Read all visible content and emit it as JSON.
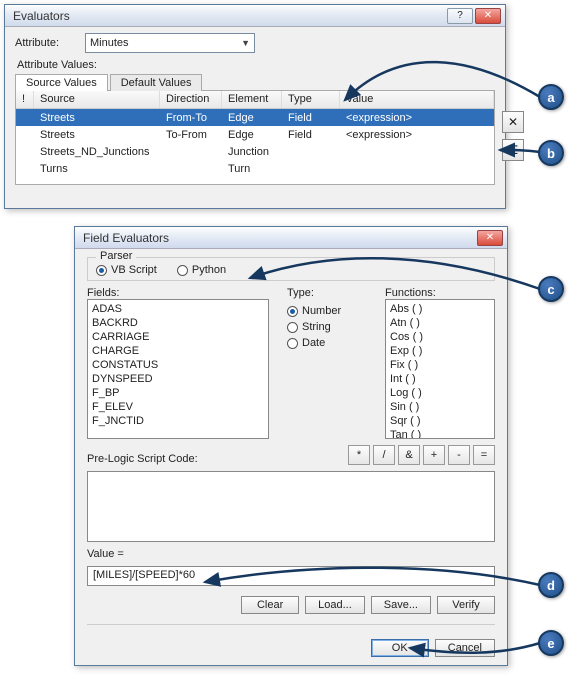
{
  "evaluators": {
    "title": "Evaluators",
    "attribute_label": "Attribute:",
    "attribute_value": "Minutes",
    "values_label": "Attribute Values:",
    "tabs": {
      "source": "Source Values",
      "default": "Default Values"
    },
    "columns": {
      "bang": "!",
      "source": "Source",
      "direction": "Direction",
      "element": "Element",
      "type": "Type",
      "value": "Value"
    },
    "rows": [
      {
        "source": "Streets",
        "direction": "From-To",
        "element": "Edge",
        "type": "Field",
        "value": "<expression>",
        "selected": true
      },
      {
        "source": "Streets",
        "direction": "To-From",
        "element": "Edge",
        "type": "Field",
        "value": "<expression>",
        "selected": false
      },
      {
        "source": "Streets_ND_Junctions",
        "direction": "",
        "element": "Junction",
        "type": "",
        "value": "",
        "selected": false
      },
      {
        "source": "Turns",
        "direction": "",
        "element": "Turn",
        "type": "",
        "value": "",
        "selected": false
      }
    ],
    "side_buttons": {
      "delete": "✕",
      "props": "☰"
    }
  },
  "field_eval": {
    "title": "Field Evaluators",
    "parser_label": "Parser",
    "parser_vb": "VB Script",
    "parser_py": "Python",
    "fields_label": "Fields:",
    "fields": [
      "ADAS",
      "BACKRD",
      "CARRIAGE",
      "CHARGE",
      "CONSTATUS",
      "DYNSPEED",
      "F_BP",
      "F_ELEV",
      "F_JNCTID"
    ],
    "type_label": "Type:",
    "type_number": "Number",
    "type_string": "String",
    "type_date": "Date",
    "functions_label": "Functions:",
    "functions": [
      "Abs ( )",
      "Atn ( )",
      "Cos ( )",
      "Exp ( )",
      "Fix ( )",
      "Int ( )",
      "Log ( )",
      "Sin ( )",
      "Sqr ( )",
      "Tan ( )"
    ],
    "prelogic_label": "Pre-Logic Script Code:",
    "ops": {
      "mul": "*",
      "div": "/",
      "amp": "&",
      "plus": "+",
      "minus": "-",
      "eq": "="
    },
    "value_label": "Value =",
    "value_expr": "[MILES]/[SPEED]*60",
    "buttons": {
      "clear": "Clear",
      "load": "Load...",
      "save": "Save...",
      "verify": "Verify",
      "ok": "OK",
      "cancel": "Cancel"
    }
  },
  "callouts": {
    "a": "a",
    "b": "b",
    "c": "c",
    "d": "d",
    "e": "e"
  }
}
